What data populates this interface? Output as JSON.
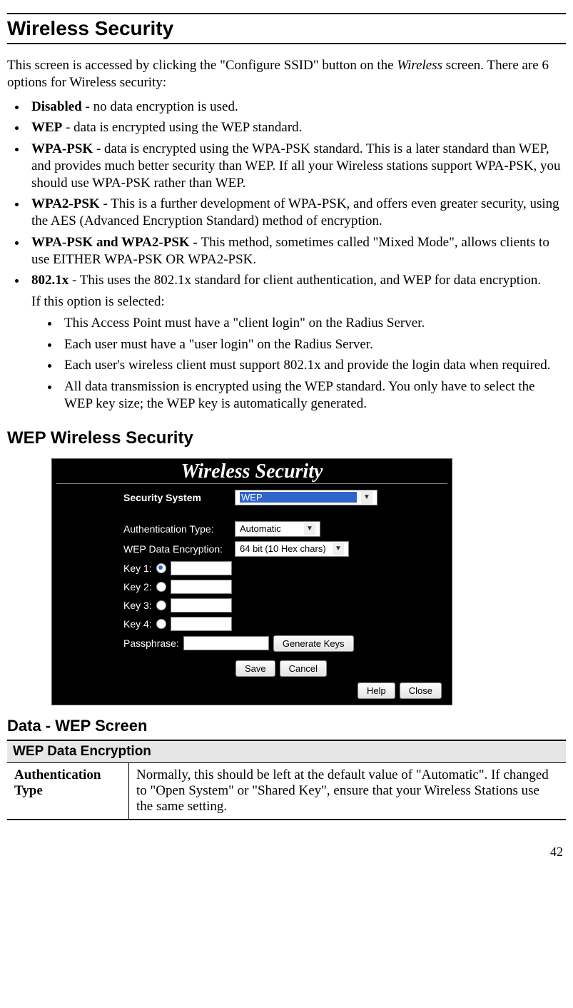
{
  "page_number": "42",
  "title_h1": "Wireless Security",
  "intro_pre": "This screen is accessed by clicking the \"Configure SSID\" button on the ",
  "intro_italic": "Wireless",
  "intro_post": " screen. There are 6 options for Wireless security:",
  "options": [
    {
      "bold": "Disabled",
      "text": " - no data encryption is used."
    },
    {
      "bold": "WEP",
      "text": " - data is encrypted using the WEP standard."
    },
    {
      "bold": "WPA-PSK",
      "text": " - data is encrypted using the WPA-PSK standard. This is a later standard than WEP, and provides much better security than WEP. If all your Wireless stations support WPA-PSK, you should use WPA-PSK rather than WEP."
    },
    {
      "bold": "WPA2-PSK",
      "text": " - This is a further development of WPA-PSK, and offers even greater security, using the AES (Advanced Encryption Standard) method of encryption."
    },
    {
      "bold": "WPA-PSK and WPA2-PSK - ",
      "text": "This method, sometimes called \"Mixed Mode\", allows clients to use EITHER WPA-PSK OR WPA2-PSK."
    },
    {
      "bold": "802.1x",
      "text": " - This uses the 802.1x standard for client authentication, and WEP for data encryption."
    }
  ],
  "option6_note": "If this option is selected:",
  "option6_sub": [
    "This Access Point must have a \"client login\" on the Radius Server.",
    "Each user must have a \"user login\" on the Radius Server.",
    "Each user's wireless client must support 802.1x and provide the login data when required.",
    "All data transmission is encrypted using the WEP standard. You only have to select the WEP key size; the WEP key is automatically generated."
  ],
  "h2_wep": "WEP Wireless Security",
  "screenshot": {
    "title": "Wireless Security",
    "security_system_label": "Security System",
    "security_system_value": "WEP",
    "auth_type_label": "Authentication Type:",
    "auth_type_value": "Automatic",
    "wep_enc_label": "WEP Data Encryption:",
    "wep_enc_value": "64 bit (10 Hex chars)",
    "keys": [
      {
        "label": "Key 1:",
        "checked": true
      },
      {
        "label": "Key 2:",
        "checked": false
      },
      {
        "label": "Key 3:",
        "checked": false
      },
      {
        "label": "Key 4:",
        "checked": false
      }
    ],
    "passphrase_label": "Passphrase:",
    "generate_btn": "Generate Keys",
    "save_btn": "Save",
    "cancel_btn": "Cancel",
    "help_btn": "Help",
    "close_btn": "Close"
  },
  "h3_table": "Data - WEP Screen",
  "table": {
    "group": "WEP Data Encryption",
    "row1_label": "Authentication Type",
    "row1_desc": "Normally, this should be left at the default value of \"Automatic\".  If changed to \"Open System\" or \"Shared Key\", ensure that your Wireless Stations use the same setting."
  }
}
